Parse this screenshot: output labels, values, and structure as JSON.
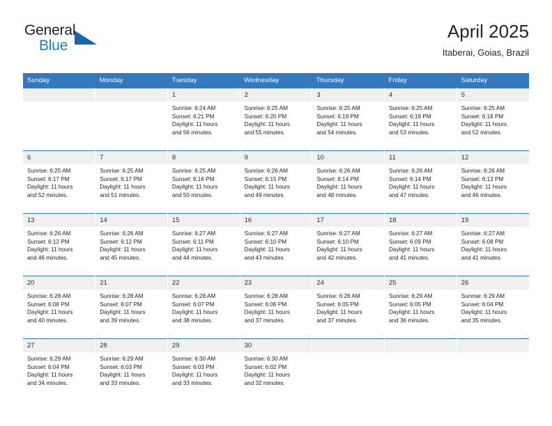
{
  "branding": {
    "logo_text_top": "General",
    "logo_text_bottom": "Blue",
    "logo_icon": "triangle-icon",
    "colors": {
      "logo_dark": "#231f20",
      "logo_blue": "#1a7ec8",
      "triangle_blue": "#1667b0",
      "header_blue": "#3678be",
      "day_band_gray": "#f0f0f0"
    }
  },
  "header": {
    "title": "April 2025",
    "subtitle": "Itaberai, Goias, Brazil"
  },
  "calendar": {
    "weekday_headers": [
      "Sunday",
      "Monday",
      "Tuesday",
      "Wednesday",
      "Thursday",
      "Friday",
      "Saturday"
    ],
    "labels": {
      "sunrise": "Sunrise:",
      "sunset": "Sunset:",
      "daylight": "Daylight:"
    },
    "weeks": [
      [
        {
          "day": "",
          "sunrise": "",
          "sunset": "",
          "daylight_line1": "",
          "daylight_line2": "",
          "empty": true
        },
        {
          "day": "",
          "sunrise": "",
          "sunset": "",
          "daylight_line1": "",
          "daylight_line2": "",
          "empty": true
        },
        {
          "day": "1",
          "sunrise": "Sunrise: 6:24 AM",
          "sunset": "Sunset: 6:21 PM",
          "daylight_line1": "Daylight: 11 hours",
          "daylight_line2": "and 56 minutes."
        },
        {
          "day": "2",
          "sunrise": "Sunrise: 6:25 AM",
          "sunset": "Sunset: 6:20 PM",
          "daylight_line1": "Daylight: 11 hours",
          "daylight_line2": "and 55 minutes."
        },
        {
          "day": "3",
          "sunrise": "Sunrise: 6:25 AM",
          "sunset": "Sunset: 6:19 PM",
          "daylight_line1": "Daylight: 11 hours",
          "daylight_line2": "and 54 minutes."
        },
        {
          "day": "4",
          "sunrise": "Sunrise: 6:25 AM",
          "sunset": "Sunset: 6:19 PM",
          "daylight_line1": "Daylight: 11 hours",
          "daylight_line2": "and 53 minutes."
        },
        {
          "day": "5",
          "sunrise": "Sunrise: 6:25 AM",
          "sunset": "Sunset: 6:18 PM",
          "daylight_line1": "Daylight: 11 hours",
          "daylight_line2": "and 52 minutes."
        }
      ],
      [
        {
          "day": "6",
          "sunrise": "Sunrise: 6:25 AM",
          "sunset": "Sunset: 6:17 PM",
          "daylight_line1": "Daylight: 11 hours",
          "daylight_line2": "and 52 minutes."
        },
        {
          "day": "7",
          "sunrise": "Sunrise: 6:25 AM",
          "sunset": "Sunset: 6:17 PM",
          "daylight_line1": "Daylight: 11 hours",
          "daylight_line2": "and 51 minutes."
        },
        {
          "day": "8",
          "sunrise": "Sunrise: 6:25 AM",
          "sunset": "Sunset: 6:16 PM",
          "daylight_line1": "Daylight: 11 hours",
          "daylight_line2": "and 50 minutes."
        },
        {
          "day": "9",
          "sunrise": "Sunrise: 6:26 AM",
          "sunset": "Sunset: 6:15 PM",
          "daylight_line1": "Daylight: 11 hours",
          "daylight_line2": "and 49 minutes."
        },
        {
          "day": "10",
          "sunrise": "Sunrise: 6:26 AM",
          "sunset": "Sunset: 6:14 PM",
          "daylight_line1": "Daylight: 11 hours",
          "daylight_line2": "and 48 minutes."
        },
        {
          "day": "11",
          "sunrise": "Sunrise: 6:26 AM",
          "sunset": "Sunset: 6:14 PM",
          "daylight_line1": "Daylight: 11 hours",
          "daylight_line2": "and 47 minutes."
        },
        {
          "day": "12",
          "sunrise": "Sunrise: 6:26 AM",
          "sunset": "Sunset: 6:13 PM",
          "daylight_line1": "Daylight: 11 hours",
          "daylight_line2": "and 46 minutes."
        }
      ],
      [
        {
          "day": "13",
          "sunrise": "Sunrise: 6:26 AM",
          "sunset": "Sunset: 6:12 PM",
          "daylight_line1": "Daylight: 11 hours",
          "daylight_line2": "and 46 minutes."
        },
        {
          "day": "14",
          "sunrise": "Sunrise: 6:26 AM",
          "sunset": "Sunset: 6:12 PM",
          "daylight_line1": "Daylight: 11 hours",
          "daylight_line2": "and 45 minutes."
        },
        {
          "day": "15",
          "sunrise": "Sunrise: 6:27 AM",
          "sunset": "Sunset: 6:11 PM",
          "daylight_line1": "Daylight: 11 hours",
          "daylight_line2": "and 44 minutes."
        },
        {
          "day": "16",
          "sunrise": "Sunrise: 6:27 AM",
          "sunset": "Sunset: 6:10 PM",
          "daylight_line1": "Daylight: 11 hours",
          "daylight_line2": "and 43 minutes."
        },
        {
          "day": "17",
          "sunrise": "Sunrise: 6:27 AM",
          "sunset": "Sunset: 6:10 PM",
          "daylight_line1": "Daylight: 11 hours",
          "daylight_line2": "and 42 minutes."
        },
        {
          "day": "18",
          "sunrise": "Sunrise: 6:27 AM",
          "sunset": "Sunset: 6:09 PM",
          "daylight_line1": "Daylight: 11 hours",
          "daylight_line2": "and 41 minutes."
        },
        {
          "day": "19",
          "sunrise": "Sunrise: 6:27 AM",
          "sunset": "Sunset: 6:08 PM",
          "daylight_line1": "Daylight: 11 hours",
          "daylight_line2": "and 41 minutes."
        }
      ],
      [
        {
          "day": "20",
          "sunrise": "Sunrise: 6:28 AM",
          "sunset": "Sunset: 6:08 PM",
          "daylight_line1": "Daylight: 11 hours",
          "daylight_line2": "and 40 minutes."
        },
        {
          "day": "21",
          "sunrise": "Sunrise: 6:28 AM",
          "sunset": "Sunset: 6:07 PM",
          "daylight_line1": "Daylight: 11 hours",
          "daylight_line2": "and 39 minutes."
        },
        {
          "day": "22",
          "sunrise": "Sunrise: 6:28 AM",
          "sunset": "Sunset: 6:07 PM",
          "daylight_line1": "Daylight: 11 hours",
          "daylight_line2": "and 38 minutes."
        },
        {
          "day": "23",
          "sunrise": "Sunrise: 6:28 AM",
          "sunset": "Sunset: 6:06 PM",
          "daylight_line1": "Daylight: 11 hours",
          "daylight_line2": "and 37 minutes."
        },
        {
          "day": "24",
          "sunrise": "Sunrise: 6:28 AM",
          "sunset": "Sunset: 6:05 PM",
          "daylight_line1": "Daylight: 11 hours",
          "daylight_line2": "and 37 minutes."
        },
        {
          "day": "25",
          "sunrise": "Sunrise: 6:29 AM",
          "sunset": "Sunset: 6:05 PM",
          "daylight_line1": "Daylight: 11 hours",
          "daylight_line2": "and 36 minutes."
        },
        {
          "day": "26",
          "sunrise": "Sunrise: 6:29 AM",
          "sunset": "Sunset: 6:04 PM",
          "daylight_line1": "Daylight: 11 hours",
          "daylight_line2": "and 35 minutes."
        }
      ],
      [
        {
          "day": "27",
          "sunrise": "Sunrise: 6:29 AM",
          "sunset": "Sunset: 6:04 PM",
          "daylight_line1": "Daylight: 11 hours",
          "daylight_line2": "and 34 minutes."
        },
        {
          "day": "28",
          "sunrise": "Sunrise: 6:29 AM",
          "sunset": "Sunset: 6:03 PM",
          "daylight_line1": "Daylight: 11 hours",
          "daylight_line2": "and 33 minutes."
        },
        {
          "day": "29",
          "sunrise": "Sunrise: 6:30 AM",
          "sunset": "Sunset: 6:03 PM",
          "daylight_line1": "Daylight: 11 hours",
          "daylight_line2": "and 33 minutes."
        },
        {
          "day": "30",
          "sunrise": "Sunrise: 6:30 AM",
          "sunset": "Sunset: 6:02 PM",
          "daylight_line1": "Daylight: 11 hours",
          "daylight_line2": "and 32 minutes."
        },
        {
          "day": "",
          "sunrise": "",
          "sunset": "",
          "daylight_line1": "",
          "daylight_line2": "",
          "empty": true
        },
        {
          "day": "",
          "sunrise": "",
          "sunset": "",
          "daylight_line1": "",
          "daylight_line2": "",
          "empty": true
        },
        {
          "day": "",
          "sunrise": "",
          "sunset": "",
          "daylight_line1": "",
          "daylight_line2": "",
          "empty": true
        }
      ]
    ]
  }
}
